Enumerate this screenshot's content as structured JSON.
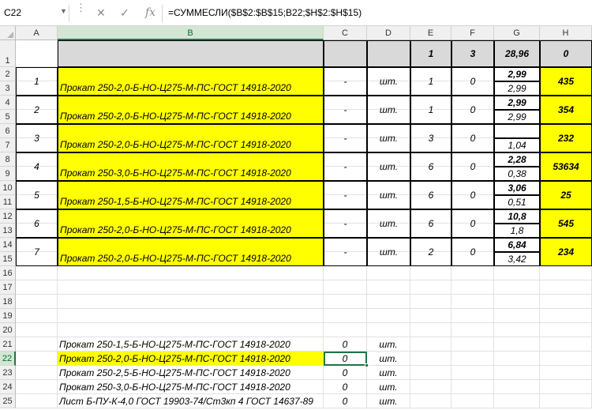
{
  "formula_bar": {
    "name_box": "C22",
    "formula": "=СУММЕСЛИ($B$2:$B$15;B22;$H$2:$H$15)",
    "icons": [
      "cancel-icon",
      "confirm-icon",
      "function-icon"
    ]
  },
  "columns": [
    "A",
    "B",
    "C",
    "D",
    "E",
    "F",
    "G",
    "H"
  ],
  "rows": [
    "1",
    "2",
    "3",
    "4",
    "5",
    "6",
    "7",
    "8",
    "9",
    "10",
    "11",
    "12",
    "13",
    "14",
    "15",
    "16",
    "17",
    "18",
    "19",
    "20",
    "21",
    "22",
    "23",
    "24",
    "25"
  ],
  "header_row": {
    "E": "1",
    "F": "3",
    "G": "28,96",
    "H": "0"
  },
  "items": [
    {
      "num": "1",
      "name": "Прокат 250-2,0-Б-НО-Ц275-М-ПС-ГОСТ 14918-2020",
      "c": "-",
      "unit": "шт.",
      "e": "1",
      "f": "0",
      "g_top": "2,99",
      "g_bottom": "2,99",
      "h": "435"
    },
    {
      "num": "2",
      "name": "Прокат 250-2,0-Б-НО-Ц275-М-ПС-ГОСТ 14918-2020",
      "c": "-",
      "unit": "шт.",
      "e": "1",
      "f": "0",
      "g_top": "2,99",
      "g_bottom": "2,99",
      "h": "354"
    },
    {
      "num": "3",
      "name": "Прокат 250-2,0-Б-НО-Ц275-М-ПС-ГОСТ 14918-2020",
      "c": "-",
      "unit": "шт.",
      "e": "3",
      "f": "0",
      "g_top": "",
      "g_bottom": "1,04",
      "h": "232"
    },
    {
      "num": "4",
      "name": "Прокат 250-3,0-Б-НО-Ц275-М-ПС-ГОСТ 14918-2020",
      "c": "-",
      "unit": "шт.",
      "e": "6",
      "f": "0",
      "g_top": "2,28",
      "g_bottom": "0,38",
      "h": "53634"
    },
    {
      "num": "5",
      "name": "Прокат 250-1,5-Б-НО-Ц275-М-ПС-ГОСТ 14918-2020",
      "c": "-",
      "unit": "шт.",
      "e": "6",
      "f": "0",
      "g_top": "3,06",
      "g_bottom": "0,51",
      "h": "25"
    },
    {
      "num": "6",
      "name": "Прокат 250-2,0-Б-НО-Ц275-М-ПС-ГОСТ 14918-2020",
      "c": "-",
      "unit": "шт.",
      "e": "6",
      "f": "0",
      "g_top": "10,8",
      "g_bottom": "1,8",
      "h": "545"
    },
    {
      "num": "7",
      "name": "Прокат 250-2,0-Б-НО-Ц275-М-ПС-ГОСТ 14918-2020",
      "c": "-",
      "unit": "шт.",
      "e": "2",
      "f": "0",
      "g_top": "6,84",
      "g_bottom": "3,42",
      "h": "234"
    }
  ],
  "summary": [
    {
      "row": "21",
      "name": "Прокат 250-1,5-Б-НО-Ц275-М-ПС-ГОСТ 14918-2020",
      "value": "0",
      "unit": "шт.",
      "highlight": false
    },
    {
      "row": "22",
      "name": "Прокат 250-2,0-Б-НО-Ц275-М-ПС-ГОСТ 14918-2020",
      "value": "0",
      "unit": "шт.",
      "highlight": true
    },
    {
      "row": "23",
      "name": "Прокат 250-2,5-Б-НО-Ц275-М-ПС-ГОСТ 14918-2020",
      "value": "0",
      "unit": "шт.",
      "highlight": false
    },
    {
      "row": "24",
      "name": "Прокат 250-3,0-Б-НО-Ц275-М-ПС-ГОСТ 14918-2020",
      "value": "0",
      "unit": "шт.",
      "highlight": false
    },
    {
      "row": "25",
      "name": "Лист Б-ПУ-К-4,0 ГОСТ 19903-74/Ст3кп 4 ГОСТ 14637-89",
      "value": "0",
      "unit": "шт.",
      "highlight": false
    }
  ],
  "colors": {
    "highlight": "#ffff00",
    "header_fill": "#d9d9d9",
    "selection": "#217346"
  }
}
